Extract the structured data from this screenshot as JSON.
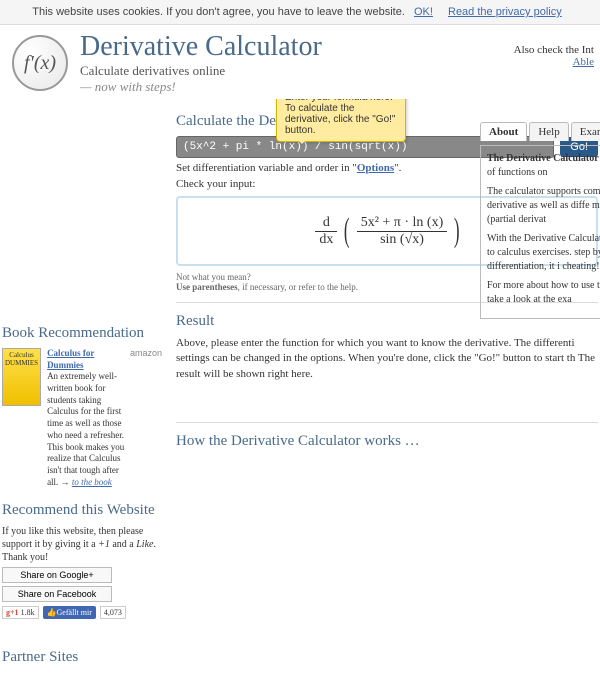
{
  "cookie": {
    "text": "This website uses cookies. If you don't agree, you have to leave the website.",
    "ok": "OK!",
    "privacy": "Read the privacy policy"
  },
  "header": {
    "title": "Derivative Calculator",
    "subtitle": "Calculate derivatives online",
    "subtitle_em": "— now with steps!",
    "also_check": "Also check the Int",
    "able": "Able"
  },
  "calc": {
    "heading": "Calculate the Derivative of …",
    "input_value": "(5x^2 + pi * ln(x)) / sin(sqrt(x))",
    "go": "Go!",
    "tooltip": "Enter your formula here. To calculate the derivative, click the \"Go!\" button.",
    "hint_pre": "Set differentiation variable and order in \"",
    "hint_link": "Options",
    "hint_post": "\".",
    "check": "Check your input:",
    "preview_ddx": "d",
    "preview_ddx2": "dx",
    "preview_num": "5x² + π · ln (x)",
    "preview_den": "sin (√x)",
    "not_mean": "Not what you mean?",
    "not_mean2": "Use parentheses",
    "not_mean3": ", if necessary, or refer to the help."
  },
  "tabs": {
    "about": "About",
    "help": "Help",
    "examples": "Examples",
    "p1a": "The Derivative Calculator",
    "p1b": " derivatives of functions on",
    "p2": "The calculator supports compu third derivative as well as diffe many variables (partial derivat",
    "p3": "With the Derivative Calculator solutions to calculus exercises. step by step differentiation, it i cheating!",
    "p4": "For more about how to use the \"Help\" or take a look at the exa"
  },
  "book": {
    "heading": "Book Recommendation",
    "amazon": "amazon",
    "title": "Calculus for Dummies",
    "cover": "Calculus DUMMIES",
    "desc": "An extremely well-written book for students taking Calculus for the first time as well as those who need a refresher. This book makes you realize that Calculus isn't that tough after all. → ",
    "to_book": "to the book"
  },
  "recommend": {
    "heading": "Recommend this Website",
    "text_pre": "If you like this website, then please support it by giving it a ",
    "plus": "+1",
    "and": " and a ",
    "like": "Like",
    "thanks": ". Thank you!",
    "share_g": "Share on Google+",
    "share_f": "Share on Facebook",
    "g_count": "1.8k",
    "f_label": "Gefällt mir",
    "f_count": "4,073"
  },
  "result": {
    "heading": "Result",
    "text": "Above, please enter the function for which you want to know the derivative. The differenti settings can be changed in the options. When you're done, click the \"Go!\" button to start th The result will be shown right here."
  },
  "partners": {
    "heading": "Partner Sites"
  },
  "how": {
    "heading": "How the Derivative Calculator works …"
  }
}
